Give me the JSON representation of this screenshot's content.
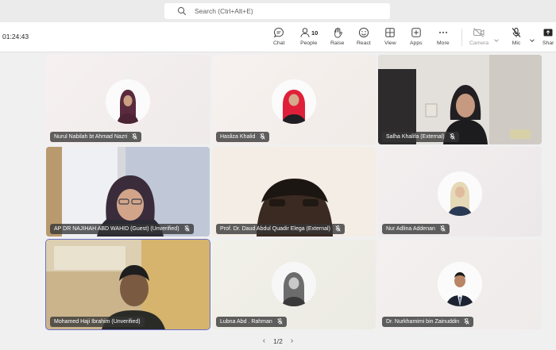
{
  "search": {
    "placeholder": "Search (Ctrl+Alt+E)",
    "icon": "search-icon"
  },
  "meeting": {
    "timer": "01:24:43"
  },
  "controls": {
    "chat": "Chat",
    "people": "People",
    "people_count": "10",
    "raise": "Raise",
    "react": "React",
    "view": "View",
    "apps": "Apps",
    "more": "More",
    "camera": "Camera",
    "mic": "Mic",
    "share": "Shar"
  },
  "participants": [
    {
      "name": "Nurul Nabilah bt Ahmad Nazri",
      "video": false,
      "muted": true
    },
    {
      "name": "Hasliza Khalid",
      "video": false,
      "muted": true
    },
    {
      "name": "Salha Khalifa (External)",
      "video": true,
      "muted": true
    },
    {
      "name": "AP DR NAJIHAH ABD WAHID (Guest) (Unverified)",
      "video": true,
      "muted": true
    },
    {
      "name": "Prof. Dr. Daud Abdul Quadir Elega (External)",
      "video": true,
      "muted": true
    },
    {
      "name": "Nur Adlina Addenan",
      "video": false,
      "muted": true
    },
    {
      "name": "Mohamed Haji Ibrahim (Unverified)",
      "video": true,
      "muted": false,
      "active": true
    },
    {
      "name": "Lubna Abd . Rahman",
      "video": false,
      "muted": true
    },
    {
      "name": "Dr. Nurkhamimi bin Zainuddin",
      "video": false,
      "muted": true
    }
  ],
  "pagination": {
    "label": "1/2"
  },
  "colors": {
    "accent": "#6b6fc9",
    "nametag_bg": "#343434"
  }
}
